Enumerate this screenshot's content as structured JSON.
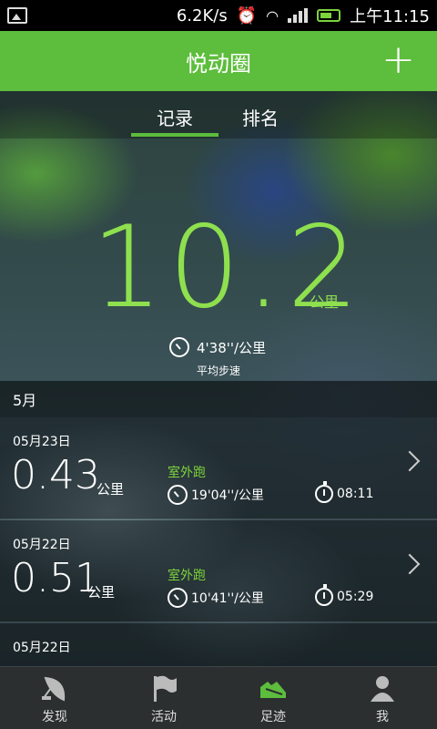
{
  "status_bar": {
    "speed": "6.2K/s",
    "time": "上午11:15"
  },
  "app_bar": {
    "title": "悦动圈",
    "add_icon": "plus-icon"
  },
  "tabs": [
    {
      "label": "记录",
      "active": true
    },
    {
      "label": "排名",
      "active": false
    }
  ],
  "summary": {
    "distance": "10.2",
    "unit": "公里",
    "pace": "4'38''/公里",
    "pace_label": "平均步速"
  },
  "month_header": "5月",
  "records": [
    {
      "date": "05月23日",
      "distance": "0.43",
      "unit": "公里",
      "type": "室外跑",
      "pace": "19'04''/公里",
      "duration": "08:11"
    },
    {
      "date": "05月22日",
      "distance": "0.51",
      "unit": "公里",
      "type": "室外跑",
      "pace": "10'41''/公里",
      "duration": "05:29"
    },
    {
      "date": "05月22日"
    }
  ],
  "bottom_nav": [
    {
      "label": "发现",
      "icon": "satellite-dish-icon"
    },
    {
      "label": "活动",
      "icon": "flag-icon"
    },
    {
      "label": "足迹",
      "icon": "shoe-icon",
      "active": true
    },
    {
      "label": "我",
      "icon": "person-icon"
    }
  ],
  "accent_color": "#5dbd3c"
}
